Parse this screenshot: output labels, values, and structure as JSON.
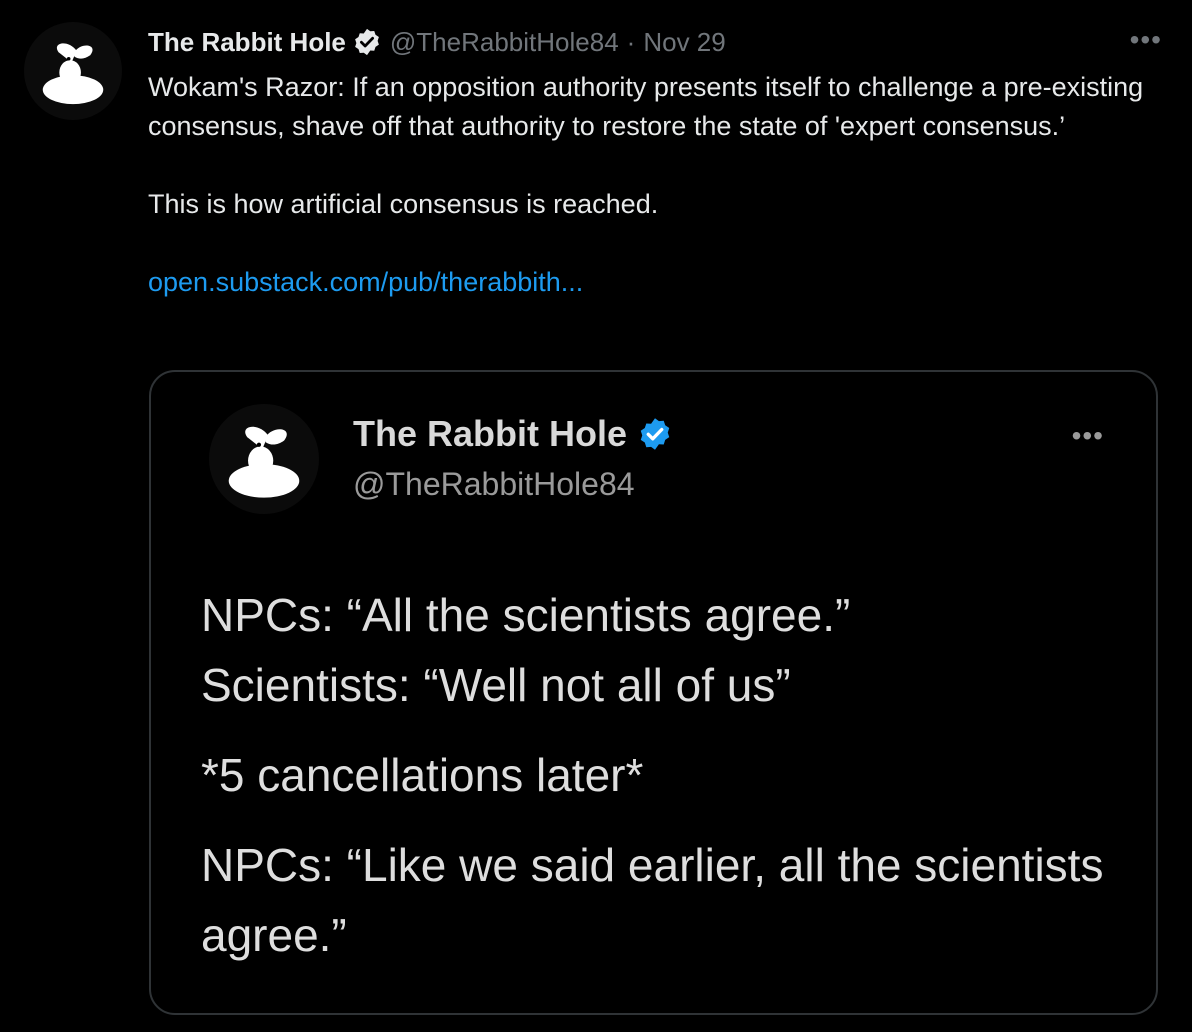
{
  "tweet": {
    "author_name": "The Rabbit Hole",
    "handle": "@TheRabbitHole84",
    "separator": "·",
    "date": "Nov 29",
    "more_label": "•••",
    "text_line1": "Wokam's Razor: If an opposition authority presents itself to challenge a pre-existing consensus, shave off that authority to restore the state of 'expert consensus.’",
    "text_line2": "This is how artificial consensus is reached.",
    "link": "open.substack.com/pub/therabbith..."
  },
  "quoted": {
    "author_name": "The Rabbit Hole",
    "handle": "@TheRabbitHole84",
    "more_label": "•••",
    "lines": [
      "NPCs: “All the scientists agree.”",
      "Scientists: “Well not all of us”",
      "*5 cancellations later*",
      "NPCs: “Like we said earlier, all the scientists agree.”"
    ]
  },
  "colors": {
    "background": "#000000",
    "text": "#e7e9ea",
    "secondary": "#71767b",
    "link": "#1d9bf0",
    "verified": "#1d9bf0",
    "border": "#2f3336"
  },
  "icons": {
    "avatar": "rabbit-logo-icon",
    "verified": "verified-badge-icon",
    "more": "more-options-icon"
  }
}
